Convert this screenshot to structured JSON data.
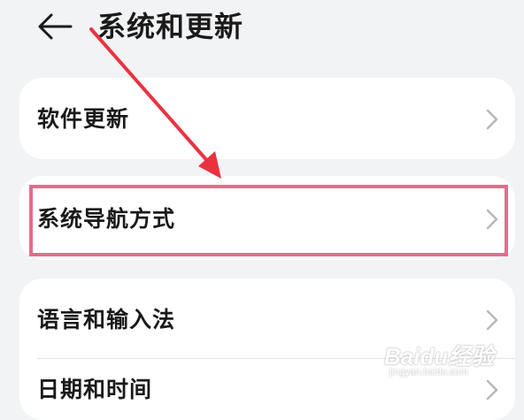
{
  "header": {
    "back_icon": "arrow-left-icon",
    "title": "系统和更新"
  },
  "sections": [
    {
      "items": [
        {
          "label": "软件更新",
          "icon": "chevron-right-icon"
        }
      ]
    },
    {
      "items": [
        {
          "label": "系统导航方式",
          "icon": "chevron-right-icon"
        }
      ]
    },
    {
      "items": [
        {
          "label": "语言和输入法",
          "icon": "chevron-right-icon"
        },
        {
          "label": "日期和时间",
          "icon": "chevron-right-icon"
        }
      ]
    }
  ],
  "annotation": {
    "highlight_color": "#e86a8c",
    "arrow_color": "#e8333f",
    "highlighted_item": "系统导航方式"
  },
  "watermark": {
    "brand": "Baidu经验",
    "url": "jingyan.baidu.com"
  },
  "colors": {
    "background": "#f1f3f5",
    "card": "#ffffff",
    "text": "#1a1a1a",
    "chevron": "#b8b8b8"
  }
}
